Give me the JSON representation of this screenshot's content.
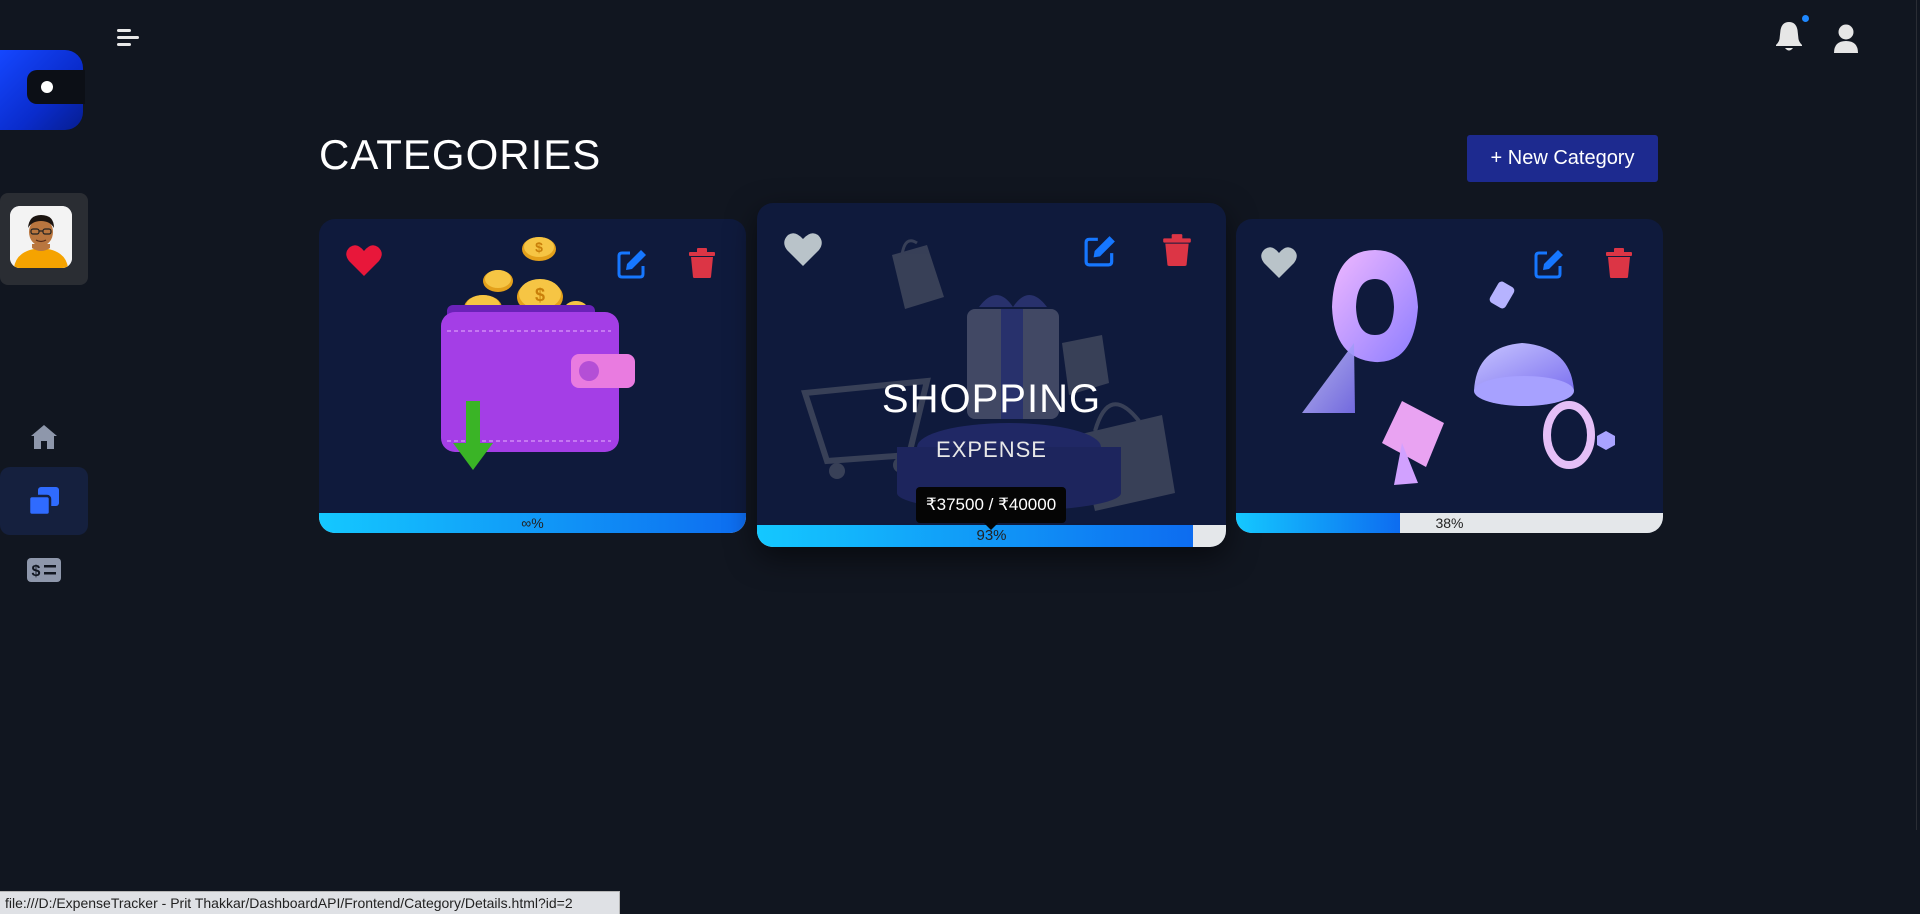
{
  "header": {
    "title": "CATEGORIES",
    "new_button_label": "+ New Category"
  },
  "sidebar": {
    "logo_icon": "wallet-toggle-logo",
    "items": [
      {
        "icon": "home-icon",
        "active": false
      },
      {
        "icon": "categories-icon",
        "active": true
      },
      {
        "icon": "transactions-icon",
        "active": false
      }
    ]
  },
  "topbar": {
    "menu_icon": "hamburger-icon",
    "notification_icon": "bell-icon",
    "profile_icon": "user-icon"
  },
  "cards": [
    {
      "favorite": true,
      "image": "purple-wallet-with-coins",
      "progress_label": "∞%",
      "progress_fraction": 1.0
    },
    {
      "favorite": false,
      "image": "shopping-gift-cart-bags",
      "title": "SHOPPING",
      "type": "EXPENSE",
      "progress_label": "93%",
      "progress_fraction": 0.93,
      "tooltip": "₹37500 / ₹40000"
    },
    {
      "favorite": false,
      "image": "abstract-3d-shapes",
      "progress_label": "38%",
      "progress_fraction": 0.38
    }
  ],
  "colors": {
    "background": "#111620",
    "card": "#0f1a3c",
    "accent_blue": "#1d2a8f",
    "edit_blue": "#1677ff",
    "delete_red": "#dc3545",
    "heart_red": "#e8173a",
    "heart_grey": "#b9c3c9"
  },
  "status_bar": {
    "url": "file:///D:/ExpenseTracker - Prit Thakkar/DashboardAPI/Frontend/Category/Details.html?id=2"
  }
}
